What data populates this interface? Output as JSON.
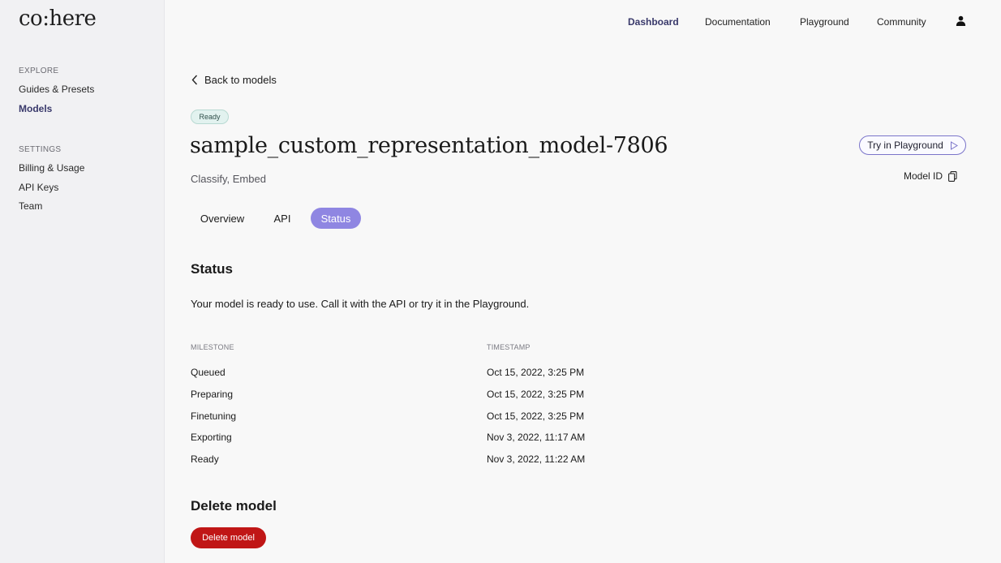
{
  "logo": "co:here",
  "sidebar": {
    "explore_label": "EXPLORE",
    "explore_items": [
      {
        "label": "Guides & Presets"
      },
      {
        "label": "Models"
      }
    ],
    "settings_label": "SETTINGS",
    "settings_items": [
      {
        "label": "Billing & Usage"
      },
      {
        "label": "API Keys"
      },
      {
        "label": "Team"
      }
    ]
  },
  "topnav": {
    "items": [
      {
        "label": "Dashboard"
      },
      {
        "label": "Documentation"
      },
      {
        "label": "Playground"
      },
      {
        "label": "Community"
      }
    ],
    "active": "Dashboard",
    "user_icon": "user-icon"
  },
  "back_link": "Back to models",
  "badge": "Ready",
  "model": {
    "title": "sample_custom_representation_model-7806",
    "subtitle": "Classify, Embed"
  },
  "actions": {
    "try_label": "Try in Playground",
    "model_id_label": "Model ID"
  },
  "tabs": [
    {
      "label": "Overview"
    },
    {
      "label": "API"
    },
    {
      "label": "Status"
    }
  ],
  "active_tab": "Status",
  "status": {
    "heading": "Status",
    "description": "Your model is ready to use. Call it with the API or try it in the Playground.",
    "columns": [
      "MILESTONE",
      "TIMESTAMP"
    ],
    "rows": [
      {
        "milestone": "Queued",
        "timestamp": "Oct 15, 2022, 3:25 PM"
      },
      {
        "milestone": "Preparing",
        "timestamp": "Oct 15, 2022, 3:25 PM"
      },
      {
        "milestone": "Finetuning",
        "timestamp": "Oct 15, 2022, 3:25 PM"
      },
      {
        "milestone": "Exporting",
        "timestamp": "Nov 3, 2022, 11:17 AM"
      },
      {
        "milestone": "Ready",
        "timestamp": "Nov 3, 2022, 11:22 AM"
      }
    ]
  },
  "delete": {
    "heading": "Delete model",
    "button": "Delete model"
  },
  "colors": {
    "accent": "#8f86e2",
    "nav_active": "#39396b",
    "danger": "#c01616"
  }
}
